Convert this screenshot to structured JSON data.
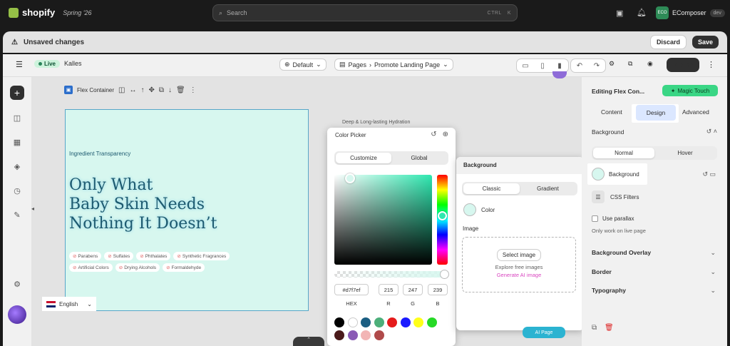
{
  "topbar": {
    "brand": "shopify",
    "edition": "Spring '26",
    "search_placeholder": "Search",
    "shortcut_ctrl": "CTRL",
    "shortcut_k": "K",
    "store_badge": "ECO",
    "store_name": "EComposer",
    "store_env": "dev"
  },
  "savebar": {
    "title": "Unsaved changes",
    "discard": "Discard",
    "save": "Save"
  },
  "toolbar": {
    "live": "Live",
    "theme": "Kalles",
    "language": "Default",
    "pages_label": "Pages",
    "page_name": "Promote Landing Page",
    "publish": "Publish"
  },
  "flex_toolbar": {
    "label": "Flex Container"
  },
  "hero": {
    "eyebrow": "Ingredient Transparency",
    "headline_1": "Only What",
    "headline_2": "Baby Skin Needs",
    "headline_3": "Nothing It Doesn’t",
    "tags": [
      "Parabens",
      "Sulfates",
      "Phthalates",
      "Synthetic Fragrances",
      "Artificial Colors",
      "Drying Alcohols",
      "Formaldehyde"
    ]
  },
  "lang_switch": {
    "label": "English"
  },
  "peek_text": "Deep & Long-lasting Hydration",
  "color_picker": {
    "title": "Color Picker",
    "tab_customize": "Customize",
    "tab_global": "Global",
    "hex_value": "#d7f7ef",
    "r": "215",
    "g": "247",
    "b": "239",
    "hex_label": "HEX",
    "r_label": "R",
    "g_label": "G",
    "b_label": "B",
    "swatches": [
      "#000000",
      "#ffffff",
      "#1b5e82",
      "#4caf7a",
      "#e51b1b",
      "#1a1aff",
      "#ffff1a",
      "#26d926",
      "#4a1a1a",
      "#8a5ab5",
      "#f2b5b5",
      "#b04a4a"
    ],
    "selected_color": "#d7f7ef"
  },
  "background_panel": {
    "title": "Background",
    "tab_classic": "Classic",
    "tab_gradient": "Gradient",
    "color_label": "Color",
    "image_label": "Image",
    "select_image": "Select image",
    "explore": "Explore free images",
    "generate_ai": "Generate AI image"
  },
  "right_panel": {
    "title": "Editing Flex Con...",
    "magic_touch": "Magic Touch",
    "tab_content": "Content",
    "tab_design": "Design",
    "tab_advanced": "Advanced",
    "section_background": "Background",
    "normal": "Normal",
    "hover": "Hover",
    "background_row": "Background",
    "css_filters": "CSS Filters",
    "use_parallax": "Use parallax",
    "parallax_hint": "Only work on live page",
    "background_overlay": "Background Overlay",
    "border": "Border",
    "typography": "Typography"
  },
  "ai_page": "AI Page"
}
